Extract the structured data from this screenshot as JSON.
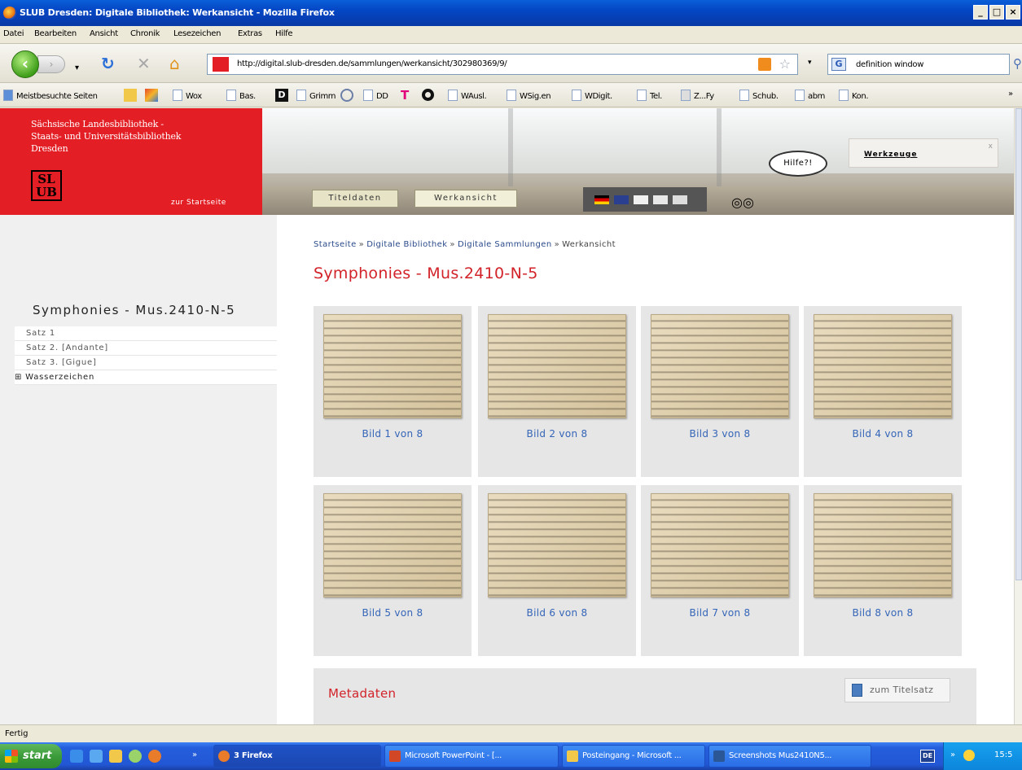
{
  "window": {
    "title": "SLUB Dresden: Digitale Bibliothek: Werkansicht - Mozilla Firefox",
    "minimize": "_",
    "maximize": "□",
    "close": "×"
  },
  "menu": [
    "Datei",
    "Bearbeiten",
    "Ansicht",
    "Chronik",
    "Lesezeichen",
    "Extras",
    "Hilfe"
  ],
  "nav": {
    "url": "http://digital.slub-dresden.de/sammlungen/werkansicht/302980369/9/",
    "search_value": "definition window",
    "back_icon": "‹",
    "forward_icon": "›",
    "reload_icon": "↻",
    "stop_icon": "✕",
    "home_icon": "⌂",
    "dropdown_icon": "▾"
  },
  "bookmarks": [
    "Meistbesuchte Seiten",
    "Wox",
    "Bas.",
    "Grimm",
    "DD",
    "WAusl.",
    "WSig.en",
    "WDigit.",
    "Tel.",
    "Z...Fy",
    "Schub.",
    "abm",
    "Kon."
  ],
  "header": {
    "library_name": [
      "Sächsische Landesbibliothek -",
      "Staats- und Universitätsbibliothek",
      "Dresden"
    ],
    "logo_text": [
      "SL",
      "UB"
    ],
    "home_link": "zur Startseite",
    "tab_titledata": "Titeldaten",
    "tab_workview": "Werkansicht",
    "help": "Hilfe?!",
    "tools": "Werkzeuge",
    "tools_close": "x"
  },
  "sidebar": {
    "title": "Symphonies - Mus.2410-N-5",
    "items": [
      "Satz 1",
      "Satz 2. [Andante]",
      "Satz 3. [Gigue]"
    ],
    "group": "⊞ Wasserzeichen"
  },
  "breadcrumb": {
    "items": [
      "Startseite",
      "Digitale Bibliothek",
      "Digitale Sammlungen"
    ],
    "current": "Werkansicht",
    "separator": "»"
  },
  "main": {
    "title": "Symphonies - Mus.2410-N-5",
    "images": [
      "Bild 1 von 8",
      "Bild 2 von 8",
      "Bild 3 von 8",
      "Bild 4 von 8",
      "Bild 5 von 8",
      "Bild 6 von 8",
      "Bild 7 von 8",
      "Bild 8 von 8"
    ],
    "metadata_title": "Metadaten",
    "metadata_button": "zum Titelsatz"
  },
  "status": "Fertig",
  "taskbar": {
    "start": "start",
    "tasks": [
      "3 Firefox",
      "Microsoft PowerPoint - [...",
      "Posteingang - Microsoft ...",
      "Screenshots Mus2410N5..."
    ],
    "lang": "DE",
    "clock": "15:5",
    "chevron": "»"
  },
  "colors": {
    "slub_red": "#e31e24",
    "title_red": "#d2232a",
    "link_blue": "#3465b8"
  }
}
